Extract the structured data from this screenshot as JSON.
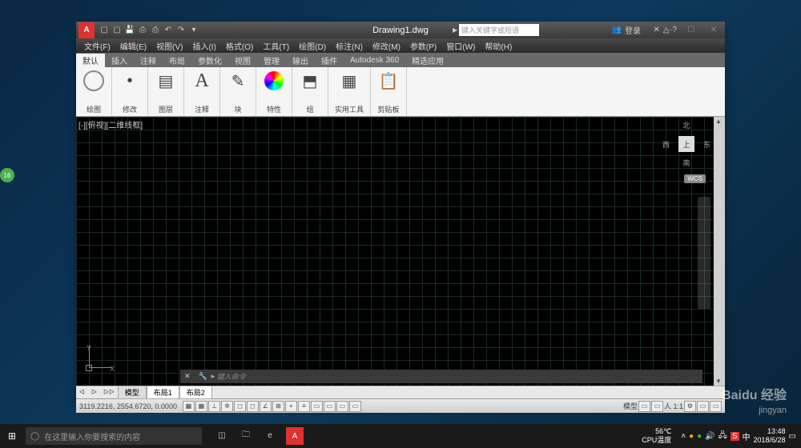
{
  "title": "Drawing1.dwg",
  "search_placeholder": "键入关键字或短语",
  "login": "登录",
  "menus": [
    "文件(F)",
    "编辑(E)",
    "视图(V)",
    "插入(I)",
    "格式(O)",
    "工具(T)",
    "绘图(D)",
    "标注(N)",
    "修改(M)",
    "参数(P)",
    "窗口(W)",
    "帮助(H)"
  ],
  "ribbon_tabs": [
    "默认",
    "插入",
    "注释",
    "布局",
    "参数化",
    "视图",
    "管理",
    "输出",
    "插件",
    "Autodesk 360",
    "精选应用"
  ],
  "panels": [
    "绘图",
    "修改",
    "图层",
    "注释",
    "块",
    "特性",
    "组",
    "实用工具",
    "剪贴板"
  ],
  "view_label": "[-][俯视][二维线框]",
  "viewcube": {
    "n": "北",
    "s": "南",
    "e": "东",
    "w": "西",
    "top": "上"
  },
  "wcs": "WCS",
  "cmd_prompt": "键入命令",
  "layout_tabs": [
    "模型",
    "布局1",
    "布局2"
  ],
  "coords": "3119.2216, 2554.6720, 0.0000",
  "status_right": {
    "model": "模型",
    "scale": "人 1:1"
  },
  "taskbar": {
    "search": "在这里输入你要搜索的内容",
    "temp": "56℃",
    "temp_label": "CPU温度",
    "time": "13:48",
    "date": "2018/6/28"
  },
  "watermark": {
    "brand": "Baidu 经验",
    "sub": "jingyan"
  },
  "ucs": {
    "x": "X",
    "y": "Y"
  },
  "annot_char": "A",
  "badge": "16"
}
